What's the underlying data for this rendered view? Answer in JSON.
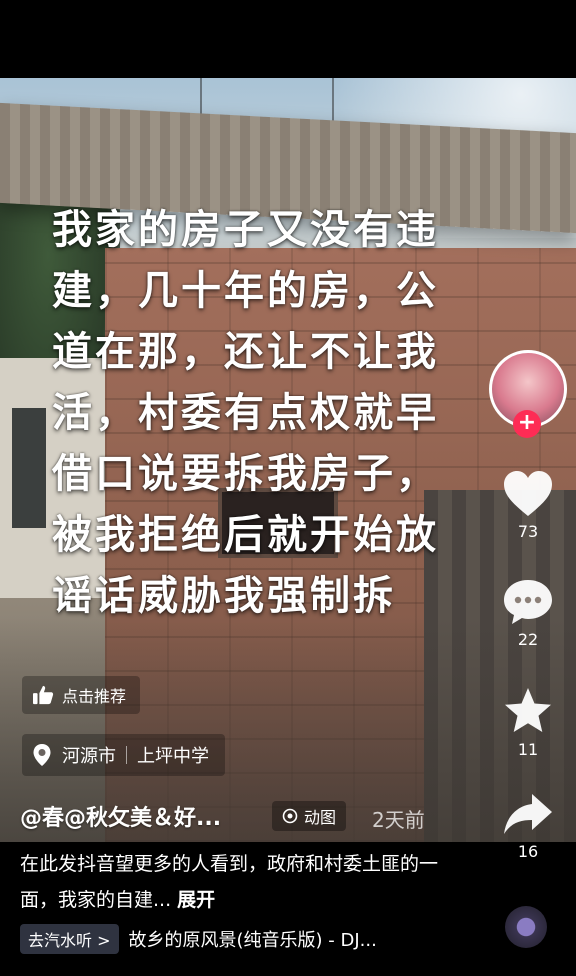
{
  "video": {
    "caption_lines": [
      "我家的房子又没有违",
      "建，几十年的房，公",
      "道在那，还让不让我",
      "活，村委有点权就早",
      "借口说要拆我房子，",
      "被我拒绝后就开始放",
      "谣话威胁我强制拆"
    ]
  },
  "overlay": {
    "like_recommend_label": "点击推荐",
    "location_city": "河源市",
    "location_place": "上坪中学"
  },
  "post": {
    "author": "@春@秋攵美＆好...",
    "tag_label": "动图",
    "time_ago": "2天前",
    "description": "在此发抖音望更多的人看到，政府和村委土匪的一面，我家的自建...",
    "expand_label": "展开"
  },
  "music": {
    "source_label": "去汽水听 >",
    "title": "故乡的原风景(纯音乐版) - DJ..."
  },
  "actions": {
    "follow_symbol": "+",
    "likes": "73",
    "comments": "22",
    "favorites": "11",
    "shares": "16"
  },
  "colors": {
    "follow_red": "#fe2c55",
    "chip_bg": "#2f3340"
  }
}
